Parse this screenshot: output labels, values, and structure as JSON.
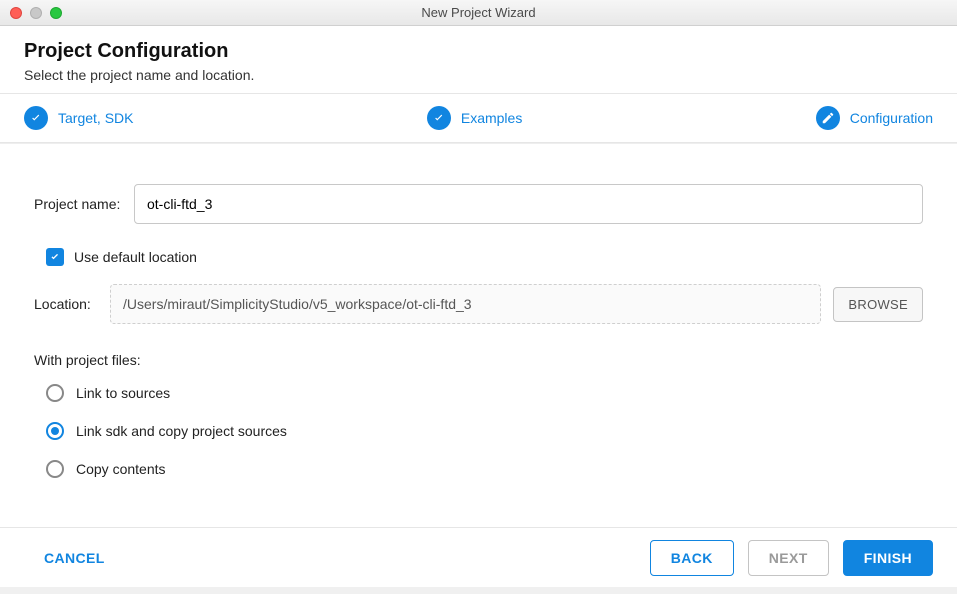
{
  "window": {
    "title": "New Project Wizard"
  },
  "header": {
    "title": "Project Configuration",
    "subtitle": "Select the project name and location."
  },
  "steps": {
    "target": "Target, SDK",
    "examples": "Examples",
    "configuration": "Configuration"
  },
  "form": {
    "project_name_label": "Project name:",
    "project_name_value": "ot-cli-ftd_3",
    "use_default_location_label": "Use default location",
    "use_default_location_checked": true,
    "location_label": "Location:",
    "location_value": "/Users/miraut/SimplicityStudio/v5_workspace/ot-cli-ftd_3",
    "browse_label": "BROWSE",
    "with_project_files_label": "With project files:",
    "radio_options": [
      {
        "label": "Link to sources",
        "selected": false
      },
      {
        "label": "Link sdk and copy project sources",
        "selected": true
      },
      {
        "label": "Copy contents",
        "selected": false
      }
    ]
  },
  "footer": {
    "cancel": "CANCEL",
    "back": "BACK",
    "next": "NEXT",
    "finish": "FINISH"
  }
}
